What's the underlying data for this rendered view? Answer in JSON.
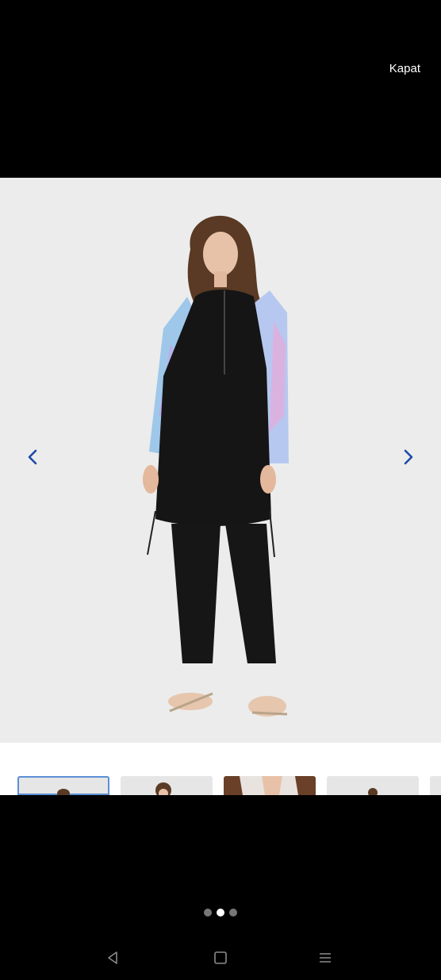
{
  "header": {
    "close_label": "Kapat"
  },
  "gallery": {
    "current_index": 1,
    "thumbnail_count_visible": 5,
    "dots": [
      {
        "active": false
      },
      {
        "active": true
      },
      {
        "active": false
      }
    ]
  },
  "colors": {
    "background": "#000000",
    "image_bg": "#ececec",
    "thumb_active_border": "#5b8fd6",
    "arrow": "#1e4aa8"
  },
  "icons": {
    "prev": "chevron-left-icon",
    "next": "chevron-right-icon",
    "back": "triangle-back-icon",
    "home": "square-home-icon",
    "menu": "hamburger-menu-icon"
  }
}
